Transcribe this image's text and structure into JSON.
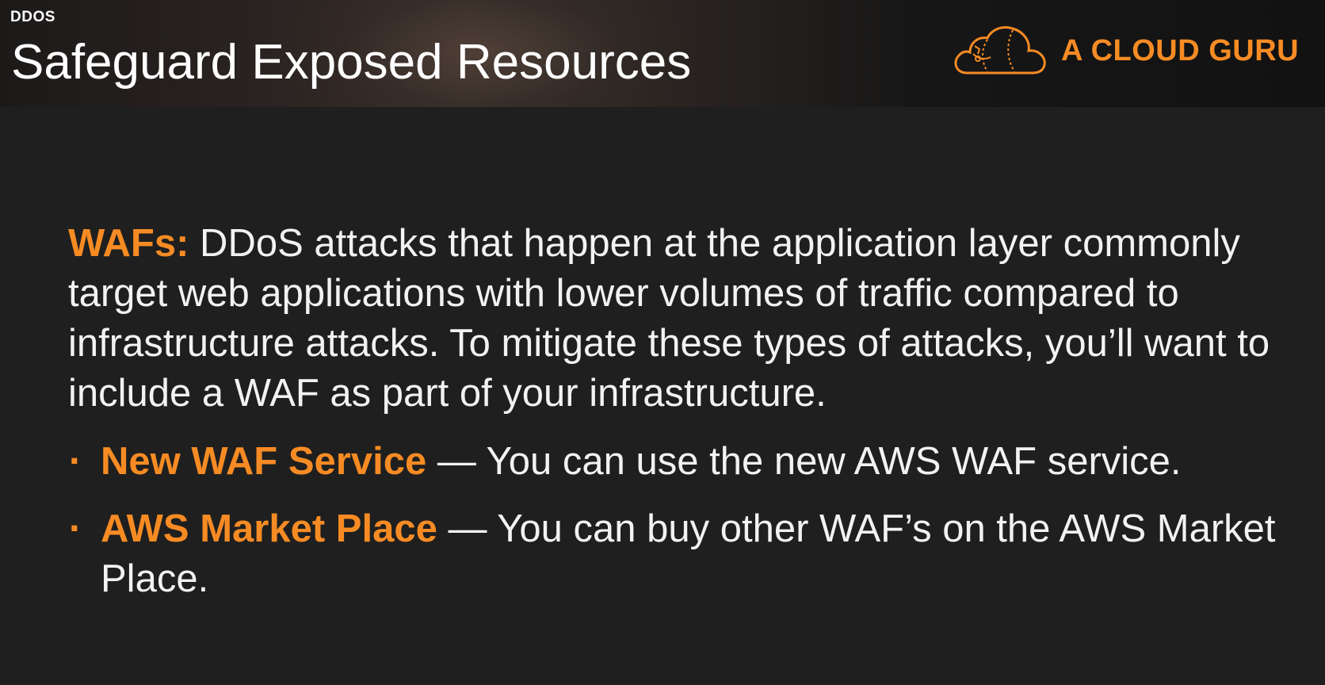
{
  "header": {
    "section_tag": "DDOS",
    "title": "Safeguard Exposed Resources",
    "logo_text": "A CLOUD GURU",
    "logo_icon": "cloud-logo-icon"
  },
  "content": {
    "intro_label": "WAFs:",
    "intro_text": " DDoS attacks that happen at the application layer commonly target web applications with lower volumes of traffic compared to infrastructure attacks. To mitigate these types of attacks, you’ll want to include a WAF as part of your infrastructure.",
    "bullet_glyph": "·",
    "bullets": [
      {
        "label": "New WAF Service",
        "text": " — You can use the new AWS WAF service."
      },
      {
        "label": "AWS Market Place",
        "text": " — You can buy other WAF’s on the AWS Market Place."
      }
    ]
  },
  "colors": {
    "accent": "#f68b24",
    "text": "#f2f2f2",
    "background": "#1f1f1f"
  }
}
